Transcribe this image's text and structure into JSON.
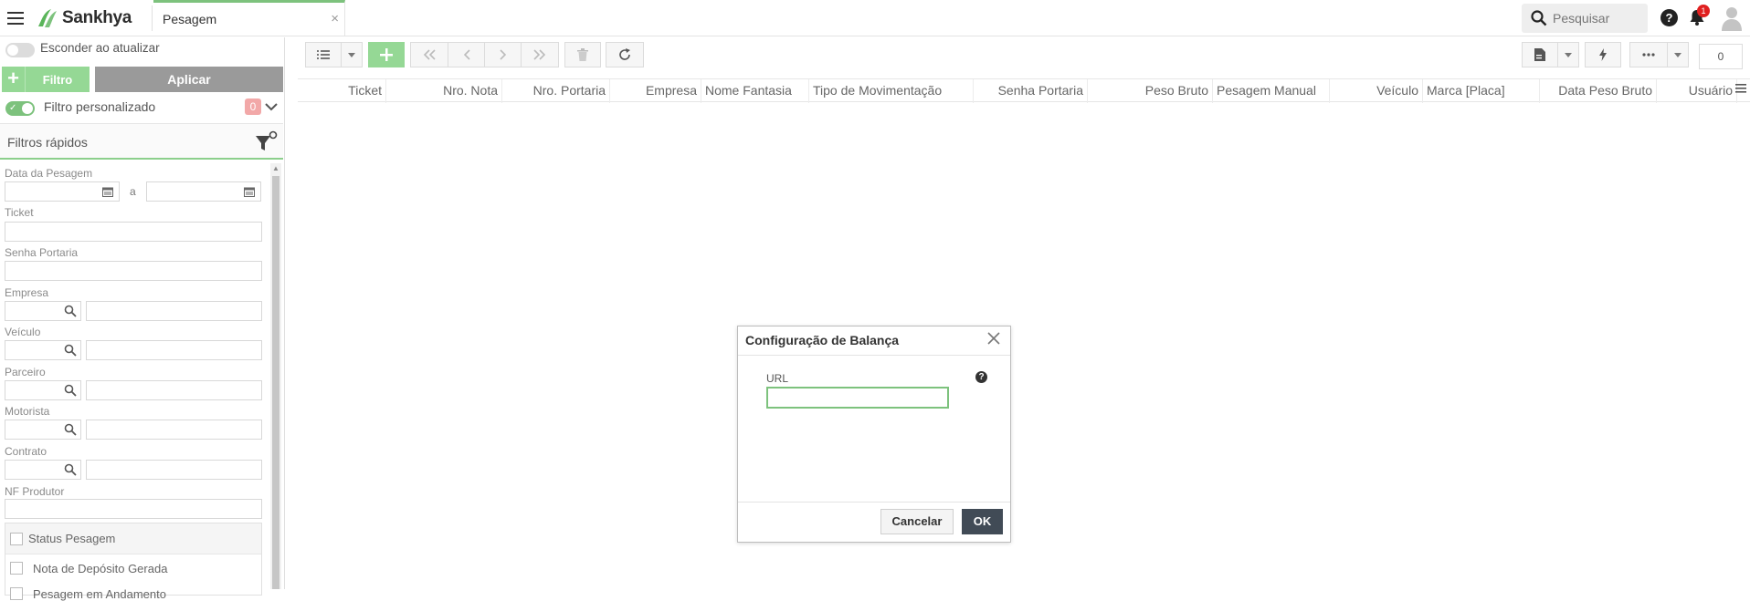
{
  "header": {
    "brand": "Sankhya",
    "tab_label": "Pesagem",
    "tab_close": "×",
    "search_placeholder": "Pesquisar",
    "help": "?",
    "notification_count": "1"
  },
  "filters": {
    "hide_on_update_label": "Esconder ao atualizar",
    "filter_button": "Filtro",
    "apply_button": "Aplicar",
    "custom_filter_label": "Filtro personalizado",
    "custom_filter_count": "0",
    "quick_filters_title": "Filtros rápidos",
    "fields": {
      "date": "Data da Pesagem",
      "date_separator": "a",
      "ticket": "Ticket",
      "senha_portaria": "Senha Portaria",
      "empresa": "Empresa",
      "veiculo": "Veículo",
      "parceiro": "Parceiro",
      "motorista": "Motorista",
      "contrato": "Contrato",
      "nf_produtor": "NF Produtor"
    },
    "status": {
      "title": "Status Pesagem",
      "options": [
        "Nota de Depósito Gerada",
        "Pesagem em Andamento"
      ]
    }
  },
  "toolbar": {
    "record_count": "0"
  },
  "grid": {
    "columns": [
      "Ticket",
      "Nro. Nota",
      "Nro. Portaria",
      "Empresa",
      "Nome Fantasia",
      "Tipo de Movimentação",
      "Senha Portaria",
      "Peso Bruto",
      "Pesagem Manual",
      "Veículo",
      "Marca [Placa]",
      "Data Peso Bruto",
      "Usuário"
    ]
  },
  "dialog": {
    "title": "Configuração de Balança",
    "url_label": "URL",
    "url_value": "",
    "help": "?",
    "cancel_label": "Cancelar",
    "ok_label": "OK"
  },
  "colors": {
    "accent_green": "#7dc27d",
    "button_green": "#95d895",
    "ok_button": "#414b56",
    "badge_red": "#e02020"
  },
  "icons": [
    "menu-icon",
    "sankhya-logo-icon",
    "search-icon",
    "help-icon",
    "bell-icon",
    "user-avatar-icon",
    "calendar-icon",
    "lookup-search-icon",
    "funnel-icon",
    "list-view-icon",
    "add-icon",
    "first-page-icon",
    "prev-page-icon",
    "next-page-icon",
    "last-page-icon",
    "trash-icon",
    "refresh-icon",
    "report-icon",
    "lightning-icon",
    "more-icon",
    "close-icon"
  ]
}
